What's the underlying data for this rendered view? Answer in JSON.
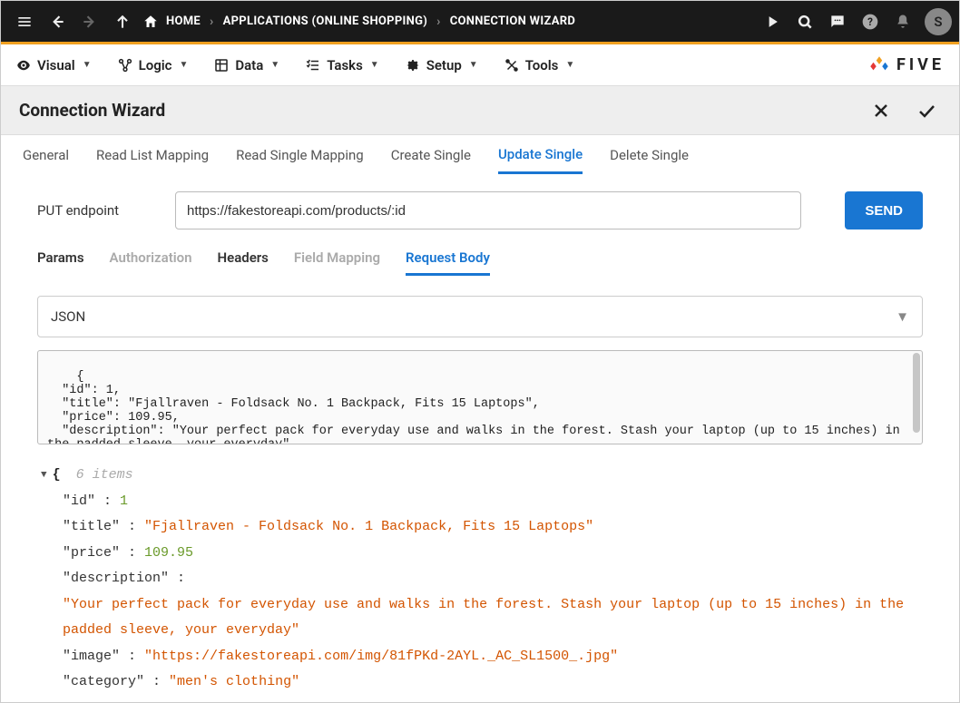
{
  "topbar": {
    "avatar_letter": "S"
  },
  "breadcrumb": {
    "home": "HOME",
    "apps": "APPLICATIONS (ONLINE SHOPPING)",
    "wizard": "CONNECTION WIZARD"
  },
  "menubar": {
    "visual": "Visual",
    "logic": "Logic",
    "data": "Data",
    "tasks": "Tasks",
    "setup": "Setup",
    "tools": "Tools",
    "brand": "FIVE"
  },
  "panel": {
    "title": "Connection Wizard"
  },
  "tabs": {
    "general": "General",
    "read_list": "Read List Mapping",
    "read_single": "Read Single Mapping",
    "create_single": "Create Single",
    "update_single": "Update Single",
    "delete_single": "Delete Single"
  },
  "endpoint": {
    "label": "PUT endpoint",
    "value": "https://fakestoreapi.com/products/:id",
    "send": "SEND"
  },
  "subtabs": {
    "params": "Params",
    "auth": "Authorization",
    "headers": "Headers",
    "field_mapping": "Field Mapping",
    "request_body": "Request Body"
  },
  "body_type": "JSON",
  "raw_body": "{\n  \"id\": 1,\n  \"title\": \"Fjallraven - Foldsack No. 1 Backpack, Fits 15 Laptops\",\n  \"price\": 109.95,\n  \"description\": \"Your perfect pack for everyday use and walks in the forest. Stash your laptop (up to 15 inches) in the padded sleeve, your everyday\",",
  "tree": {
    "items_label": "6 items",
    "id_key": "\"id\" :",
    "id_val": "1",
    "title_key": "\"title\" :",
    "title_val": "\"Fjallraven - Foldsack No. 1 Backpack, Fits 15 Laptops\"",
    "price_key": "\"price\" :",
    "price_val": "109.95",
    "desc_key": "\"description\" :",
    "desc_val": "\"Your perfect pack for everyday use and walks in the forest. Stash your laptop (up to 15 inches) in the padded sleeve, your everyday\"",
    "image_key": "\"image\" :",
    "image_val": "\"https://fakestoreapi.com/img/81fPKd-2AYL._AC_SL1500_.jpg\"",
    "cat_key": "\"category\" :",
    "cat_val": "\"men's clothing\""
  }
}
